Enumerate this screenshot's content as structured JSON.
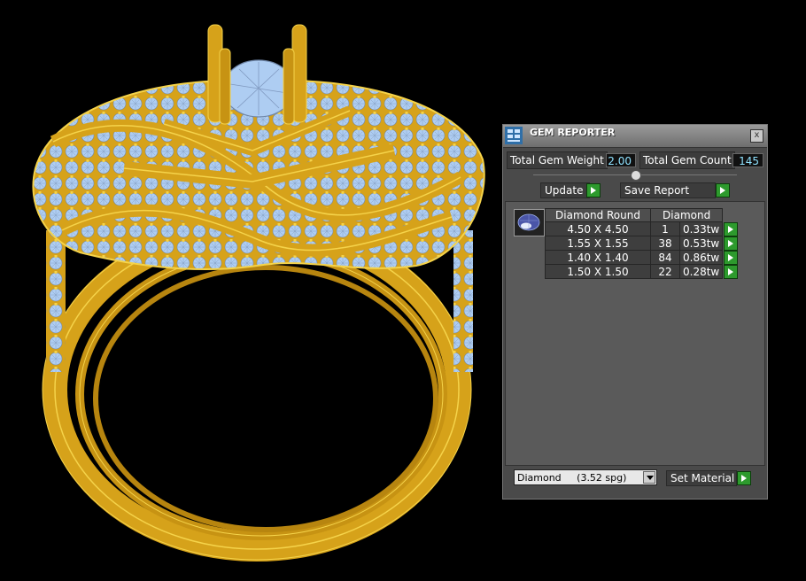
{
  "panel": {
    "title": "GEM REPORTER",
    "close_label": "x",
    "total_gem_weight_label": "Total Gem Weight",
    "total_gem_weight_value": "2.00",
    "total_gem_count_label": "Total Gem Count",
    "total_gem_count_value": "145",
    "update_label": "Update",
    "save_report_label": "Save Report",
    "table": {
      "headers": [
        "Diamond Round",
        "Diamond"
      ],
      "rows": [
        {
          "size": "4.50 X 4.50",
          "count": "1",
          "weight": "0.33tw"
        },
        {
          "size": "1.55 X 1.55",
          "count": "38",
          "weight": "0.53tw"
        },
        {
          "size": "1.40 X 1.40",
          "count": "84",
          "weight": "0.86tw"
        },
        {
          "size": "1.50 X 1.50",
          "count": "22",
          "weight": "0.28tw"
        }
      ]
    },
    "material_select_value": "Diamond     (3.52 spg)",
    "set_material_label": "Set Material"
  },
  "colors": {
    "gold": "#d6a21a",
    "gold_edge": "#f5d34a",
    "gem": "#aecdf2",
    "value_text": "#8fe2ff",
    "go_green": "#2d9a2d"
  }
}
